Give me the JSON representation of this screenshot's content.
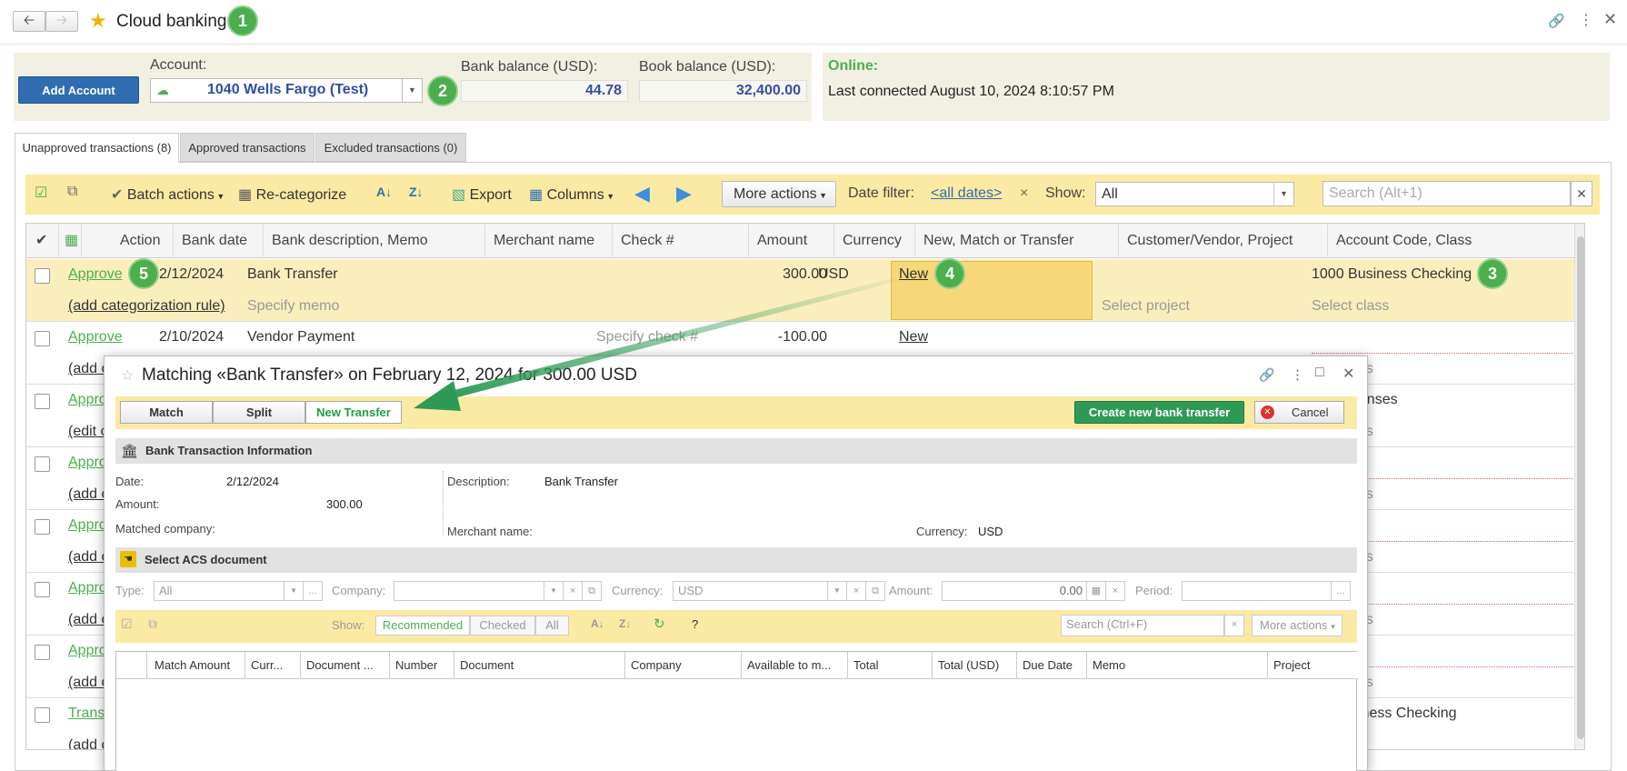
{
  "window": {
    "title": "Cloud banking"
  },
  "callouts": [
    "1",
    "2",
    "3",
    "4",
    "5"
  ],
  "account": {
    "add_button": "Add Account",
    "label": "Account:",
    "value": "1040 Wells Fargo (Test)",
    "bank_balance_label": "Bank balance (USD):",
    "bank_balance": "44.78",
    "book_balance_label": "Book balance (USD):",
    "book_balance": "32,400.00",
    "online_label": "Online:",
    "last_connected": "Last connected August 10, 2024 8:10:57 PM"
  },
  "tabs": [
    "Unapproved transactions (8)",
    "Approved transactions",
    "Excluded transactions (0)"
  ],
  "toolbar": {
    "batch_actions": "Batch actions",
    "recategorize": "Re-categorize",
    "export": "Export",
    "columns": "Columns",
    "more_actions": "More actions",
    "date_filter_label": "Date filter:",
    "date_filter_value": "<all dates>",
    "show_label": "Show:",
    "show_value": "All",
    "search_placeholder": "Search (Alt+1)"
  },
  "columns": [
    "Action",
    "Bank date",
    "Bank description, Memo",
    "Merchant name",
    "Check #",
    "Amount",
    "Currency",
    "New, Match or Transfer",
    "Customer/Vendor, Project",
    "Account Code, Class"
  ],
  "rows": [
    {
      "action": "Approve",
      "date": "2/12/2024",
      "desc": "Bank Transfer",
      "amount": "300.00",
      "currency": "USD",
      "nmt": "New",
      "account": "1000 Business Checking",
      "sub_action": "(add categorization rule)",
      "memo": "Specify memo",
      "project": "Select project",
      "class": "Select class"
    },
    {
      "action": "Approve",
      "date": "2/10/2024",
      "desc": "Vendor Payment",
      "check": "Specify check #",
      "amount": "-100.00",
      "nmt": "New",
      "sub_action": "(add c",
      "class": "ass"
    },
    {
      "action": "Appro",
      "sub_action": "(edit c",
      "account": "penses",
      "class": "ass"
    },
    {
      "action": "Appro",
      "sub_action": "(add c",
      "class": "ass"
    },
    {
      "action": "Appro",
      "sub_action": "(add c",
      "class": "ass"
    },
    {
      "action": "Appro",
      "sub_action": "(add c",
      "class": "ass"
    },
    {
      "action": "Appro",
      "sub_action": "(add c",
      "class": "ass"
    },
    {
      "action": "Trans",
      "sub_action": "(add c",
      "account": "siness Checking"
    }
  ],
  "dialog": {
    "title": "Matching «Bank Transfer» on February 12, 2024 for 300.00 USD",
    "modes": [
      "Match",
      "Split",
      "New Transfer"
    ],
    "create_button": "Create new bank transfer",
    "cancel_button": "Cancel",
    "section_bank": "Bank Transaction Information",
    "date_label": "Date:",
    "date": "2/12/2024",
    "amount_label": "Amount:",
    "amount": "300.00",
    "matched_company_label": "Matched company:",
    "description_label": "Description:",
    "description": "Bank Transfer",
    "merchant_label": "Merchant name:",
    "currency_label": "Currency:",
    "currency": "USD",
    "section_select": "Select ACS document",
    "filters": {
      "type_label": "Type:",
      "type": "All",
      "company_label": "Company:",
      "currency_label": "Currency:",
      "currency": "USD",
      "amount_label": "Amount:",
      "amount": "0.00",
      "period_label": "Period:"
    },
    "show_label": "Show:",
    "show_options": [
      "Recommended",
      "Checked",
      "All"
    ],
    "search_placeholder": "Search (Ctrl+F)",
    "more_actions": "More actions",
    "grid_columns": [
      "Match Amount",
      "Curr...",
      "Document ...",
      "Number",
      "Document",
      "Company",
      "Available to m...",
      "Total",
      "Total (USD)",
      "Due Date",
      "Memo",
      "Project"
    ]
  },
  "colors": {
    "accent_green": "#4caf50",
    "toolbar_yellow": "#fbeaa3",
    "primary_blue": "#2f6db0"
  }
}
